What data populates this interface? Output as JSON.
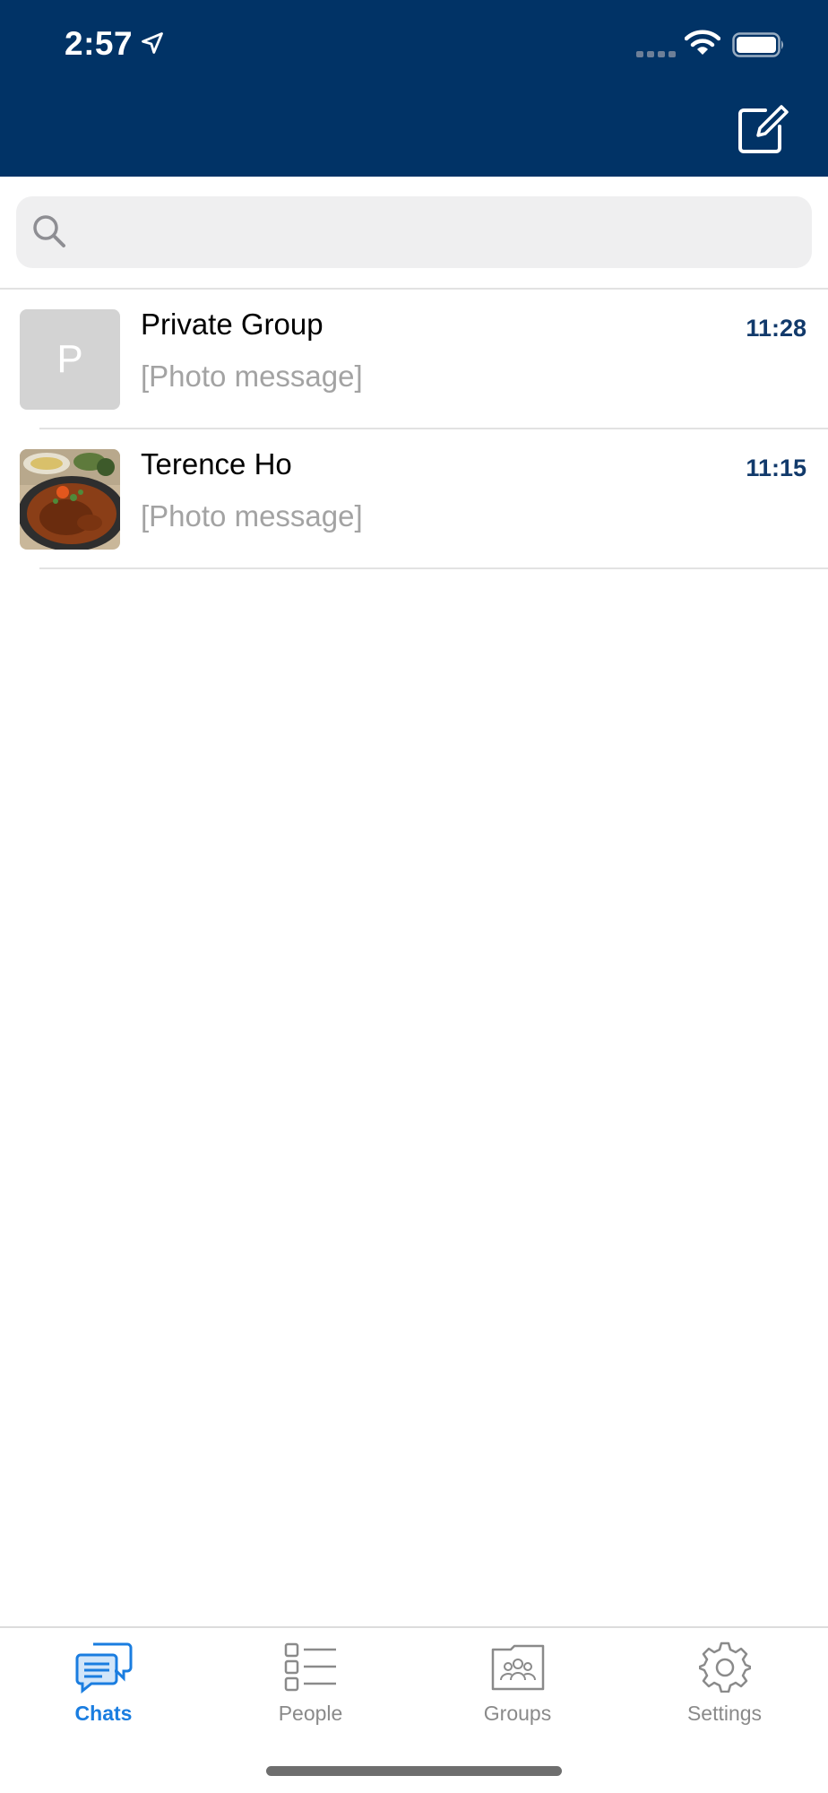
{
  "status_bar": {
    "time": "2:57"
  },
  "header": {
    "compose_icon": "compose-icon"
  },
  "search": {
    "placeholder": ""
  },
  "chats": [
    {
      "name": "Private Group",
      "preview": "[Photo message]",
      "time": "11:28",
      "avatar_letter": "P"
    },
    {
      "name": "Terence Ho",
      "preview": "[Photo message]",
      "time": "11:15",
      "avatar_letter": ""
    }
  ],
  "tabs": [
    {
      "label": "Chats",
      "icon": "chats-icon",
      "active": true
    },
    {
      "label": "People",
      "icon": "people-list-icon",
      "active": false
    },
    {
      "label": "Groups",
      "icon": "groups-icon",
      "active": false
    },
    {
      "label": "Settings",
      "icon": "settings-gear-icon",
      "active": false
    }
  ],
  "colors": {
    "header": "#013366",
    "accent": "#1a7de0",
    "time": "#123a6b"
  }
}
